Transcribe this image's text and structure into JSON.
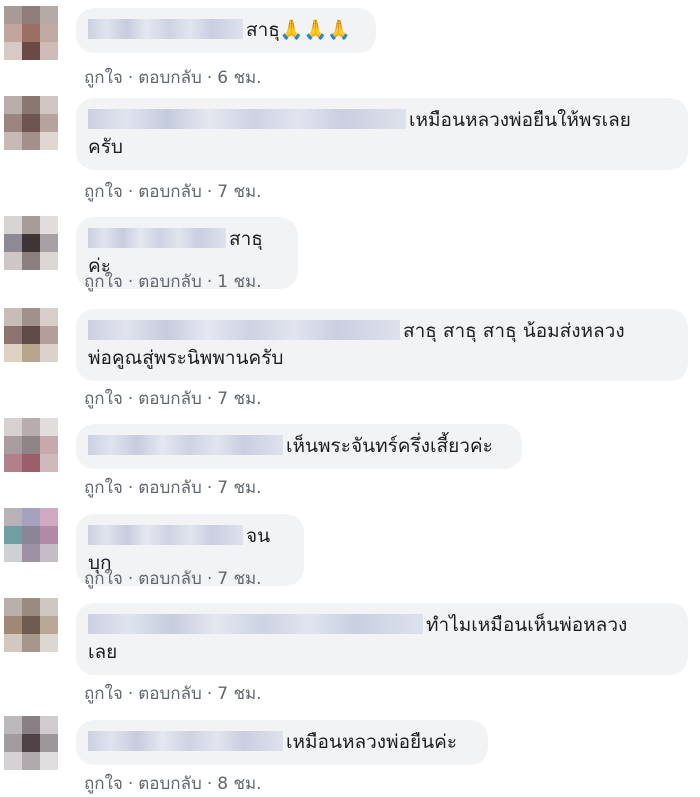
{
  "like_label": "ถูกใจ",
  "reply_label": "ตอบกลับ",
  "separator": "·",
  "comments": [
    {
      "text": "สาธุ🙏🙏🙏",
      "time": "6 ชม.",
      "avatar": [
        "#a89a94",
        "#8e7d78",
        "#b5aaa6",
        "#c2a59c",
        "#9b6f66",
        "#bfa9a2",
        "#d7c9c4",
        "#6b4a46",
        "#cdbcb7"
      ]
    },
    {
      "text": "เหมือนหลวงพ่อยืนให้พรเลย\nครับ",
      "time": "7 ชม.",
      "avatar": [
        "#b9aeab",
        "#8a7772",
        "#cfc6c2",
        "#9c8580",
        "#6e5550",
        "#b7a39e",
        "#c7bab6",
        "#a48f8a",
        "#e0d7d3"
      ]
    },
    {
      "text": "สาธุค่ะ",
      "time": "1 ชม.",
      "avatar": [
        "#d9d4d4",
        "#a79c9a",
        "#e2dddd",
        "#8d8a96",
        "#3f3535",
        "#a7a1a6",
        "#cfc7c6",
        "#8a7f7e",
        "#dcd6d5"
      ]
    },
    {
      "text": "สาธุ สาธุ สาธุ น้อมส่งหลวง\nพ่อคูณสู่พระนิพพานครับ",
      "time": "7 ชม.",
      "avatar": [
        "#c7bcb8",
        "#a1908b",
        "#d8cfcc",
        "#8c7470",
        "#5e4a46",
        "#b39f9a",
        "#e0d2c2",
        "#b9a58e",
        "#ddd2c9"
      ]
    },
    {
      "text": "เห็นพระจันทร์ครึ่งเสี้ยวค่ะ",
      "time": "7 ชม.",
      "avatar": [
        "#d6d0d0",
        "#b7adad",
        "#e3dcdc",
        "#a99c9e",
        "#8f8486",
        "#c9a8ad",
        "#b27f8a",
        "#9b5f6c",
        "#d0b9bd"
      ]
    },
    {
      "text": "จนบุก",
      "time": "7 ชม.",
      "avatar": [
        "#b9b1b8",
        "#a6a1bd",
        "#d0a9c2",
        "#6f9ea3",
        "#8b8697",
        "#b08aa6",
        "#cdd0d4",
        "#9d8fa4",
        "#c6bcc8"
      ]
    },
    {
      "text": "ทำไมเหมือนเห็นพ่อหลวง\nเลย",
      "time": "7 ชม.",
      "avatar": [
        "#b9b0aa",
        "#9a8a80",
        "#cec6c0",
        "#a08874",
        "#6e5a4e",
        "#b9a696",
        "#d2c8c0",
        "#a6968c",
        "#ded6d0"
      ]
    },
    {
      "text": "เหมือนหลวงพ่อยืนค่ะ",
      "time": "8 ชม.",
      "avatar": [
        "#bcb8bb",
        "#8a7f84",
        "#cfcbce",
        "#a29ba0",
        "#4f4247",
        "#9f969b",
        "#d5d1d4",
        "#b0a9ad",
        "#e1dee0"
      ]
    }
  ]
}
